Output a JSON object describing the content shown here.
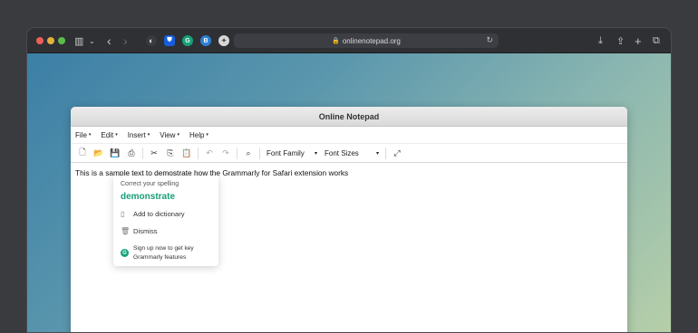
{
  "browser": {
    "url": "onlinenotepad.org",
    "icons": {
      "sidebar": "▥",
      "chevron": "⌄",
      "back": "‹",
      "forward": "›",
      "shield": "◐",
      "bitwarden": "⛊",
      "grammarly": "G",
      "blue_ext": "B",
      "gear_ext": "✦",
      "lock": "🔒",
      "reload": "↻",
      "download": "⤓",
      "share": "⇪",
      "new_tab": "+",
      "tabs": "⧉"
    }
  },
  "notepad": {
    "title": "Online Notepad",
    "menus": [
      {
        "label": "File"
      },
      {
        "label": "Edit"
      },
      {
        "label": "Insert"
      },
      {
        "label": "View"
      },
      {
        "label": "Help"
      }
    ],
    "caret": "▾",
    "toolbar": {
      "new": "🗋",
      "open": "📂",
      "save": "💾",
      "print": "⎙",
      "cut": "✂",
      "copy": "⎘",
      "paste": "📋",
      "undo": "↶",
      "redo": "↷",
      "find": "⌕",
      "font_family": "Font Family",
      "font_sizes": "Font Sizes",
      "fullscreen": "⤢"
    },
    "text_before": "This is a sample text to ",
    "misspelled": "demostrate",
    "text_after": " how the Grammarly for Safari extension works"
  },
  "grammarly": {
    "heading": "Correct your spelling",
    "suggestion": "demonstrate",
    "add_to_dictionary": "Add to dictionary",
    "dismiss": "Dismiss",
    "signup_line1": "Sign up now to get key",
    "signup_line2": "Grammarly features",
    "logo": "G"
  }
}
